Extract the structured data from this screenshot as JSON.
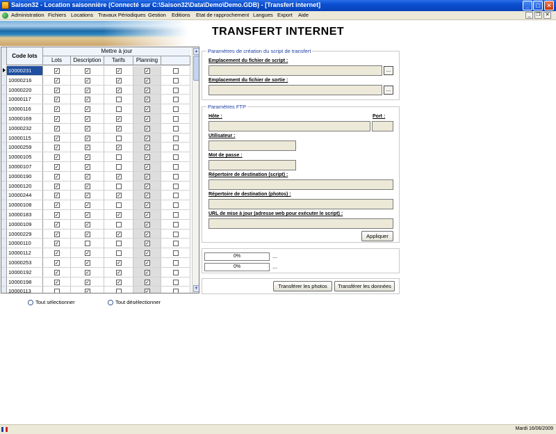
{
  "window": {
    "title": "Saison32 - Location saisonnière (Connecté sur C:\\Saison32\\Data\\Demo\\Demo.GDB) - [Transfert internet]",
    "minimize_glyph": "_",
    "maximize_glyph": "□",
    "close_glyph": "✕"
  },
  "menu": {
    "items": [
      "Administration",
      "Fichiers",
      "Locations",
      "Travaux Périodiques",
      "Gestion",
      "Editions",
      "Etat de rapprochement",
      "Langues",
      "Export",
      "Aide"
    ],
    "child_minimize_glyph": "_",
    "child_restore_glyph": "❐",
    "child_close_glyph": "✕"
  },
  "banner": {
    "title": "TRANSFERT INTERNET"
  },
  "grid": {
    "code_header": "Code lots",
    "group_header": "Mettre à jour",
    "sub_headers": [
      "Lots",
      "Description",
      "Tarifs",
      "Planning",
      ""
    ],
    "check_glyph": "✓",
    "rows": [
      {
        "code": "10000231",
        "checks": [
          true,
          true,
          true,
          true,
          false
        ]
      },
      {
        "code": "10000216",
        "checks": [
          true,
          true,
          true,
          true,
          false
        ]
      },
      {
        "code": "10000220",
        "checks": [
          true,
          true,
          true,
          true,
          false
        ]
      },
      {
        "code": "10000117",
        "checks": [
          true,
          true,
          false,
          true,
          false
        ]
      },
      {
        "code": "10000116",
        "checks": [
          true,
          true,
          false,
          true,
          false
        ]
      },
      {
        "code": "10000169",
        "checks": [
          true,
          true,
          true,
          true,
          false
        ]
      },
      {
        "code": "10000232",
        "checks": [
          true,
          true,
          true,
          true,
          false
        ]
      },
      {
        "code": "10000115",
        "checks": [
          true,
          true,
          false,
          true,
          false
        ]
      },
      {
        "code": "10000259",
        "checks": [
          true,
          true,
          true,
          true,
          false
        ]
      },
      {
        "code": "10000105",
        "checks": [
          true,
          true,
          false,
          true,
          false
        ]
      },
      {
        "code": "10000107",
        "checks": [
          true,
          true,
          false,
          true,
          false
        ]
      },
      {
        "code": "10000190",
        "checks": [
          true,
          true,
          true,
          true,
          false
        ]
      },
      {
        "code": "10000120",
        "checks": [
          true,
          true,
          false,
          true,
          false
        ]
      },
      {
        "code": "10000244",
        "checks": [
          true,
          true,
          true,
          true,
          false
        ]
      },
      {
        "code": "10000108",
        "checks": [
          true,
          true,
          false,
          true,
          false
        ]
      },
      {
        "code": "10000183",
        "checks": [
          true,
          true,
          true,
          true,
          false
        ]
      },
      {
        "code": "10000109",
        "checks": [
          true,
          true,
          false,
          true,
          false
        ]
      },
      {
        "code": "10000229",
        "checks": [
          true,
          true,
          true,
          true,
          false
        ]
      },
      {
        "code": "10000110",
        "checks": [
          true,
          false,
          false,
          true,
          false
        ]
      },
      {
        "code": "10000112",
        "checks": [
          true,
          true,
          false,
          true,
          false
        ]
      },
      {
        "code": "10000253",
        "checks": [
          true,
          true,
          true,
          true,
          false
        ]
      },
      {
        "code": "10000192",
        "checks": [
          true,
          true,
          true,
          true,
          false
        ]
      },
      {
        "code": "10000198",
        "checks": [
          true,
          true,
          true,
          true,
          false
        ]
      },
      {
        "code": "10000113",
        "checks": [
          false,
          true,
          false,
          true,
          false
        ]
      }
    ],
    "scroll_up_glyph": "▲",
    "scroll_down_glyph": "▼"
  },
  "selection": {
    "select_all": "Tout sélectionner",
    "deselect_all": "Tout désélectionner"
  },
  "script_params": {
    "legend": "Paramètres de création du script de transfert",
    "script_location_label": "Emplacement du fichier de script :",
    "script_location_value": "",
    "output_location_label": "Emplacement du fichier de sortie :",
    "output_location_value": "",
    "browse_label": "..."
  },
  "ftp": {
    "legend": "Paramètres FTP",
    "host_label": "Hôte :",
    "host_value": "",
    "port_label": "Port :",
    "port_value": "",
    "user_label": "Utilisateur :",
    "user_value": "",
    "password_label": "Mot de passe :",
    "password_value": "",
    "dest_script_label": "Répertoire de destination (script) :",
    "dest_script_value": "",
    "dest_photos_label": "Répertoire de destination (photos) :",
    "dest_photos_value": "",
    "url_label": "URL de mise à jour (adresse web pour exécuter le script) :",
    "url_value": "",
    "apply_label": "Appliquer"
  },
  "progress": {
    "bars": [
      {
        "text": "0%",
        "value": 0,
        "trail": "..."
      },
      {
        "text": "0%",
        "value": 0,
        "trail": "..."
      }
    ],
    "fill_color": "#3c78d8"
  },
  "actions": {
    "transfer_photos": "Transférer les photos",
    "transfer_data": "Transférer les données"
  },
  "status": {
    "date": "Mardi 16/06/2009"
  }
}
